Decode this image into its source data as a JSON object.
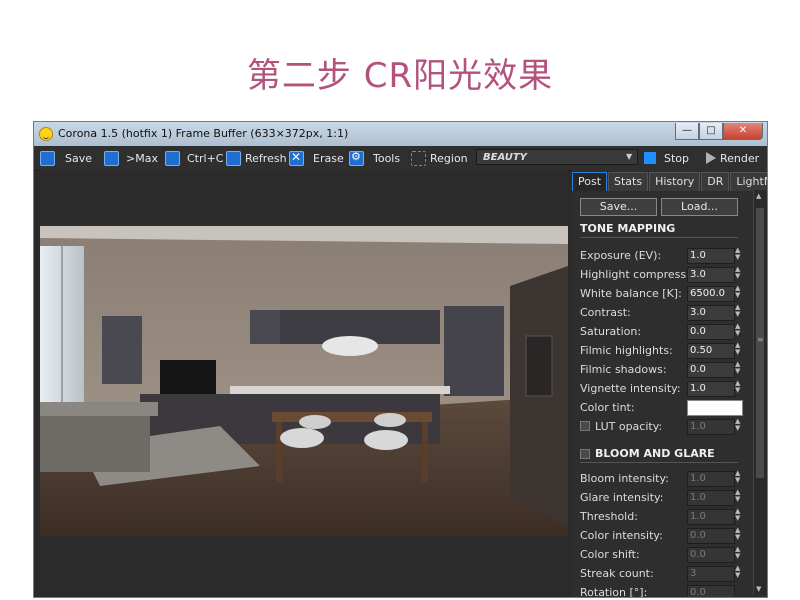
{
  "heading": "第二步  CR阳光效果",
  "window": {
    "title": "Corona 1.5 (hotfix 1) Frame Buffer (633×372px, 1:1)",
    "controls": {
      "minimize": "—",
      "maximize": "□",
      "close": "✕"
    }
  },
  "toolbar": {
    "save": "Save",
    "max": ">Max",
    "ctrl_c": "Ctrl+C",
    "refresh": "Refresh",
    "erase": "Erase",
    "tools": "Tools",
    "region": "Region",
    "pass_select": "BEAUTY",
    "stop": "Stop",
    "render": "Render"
  },
  "panel": {
    "tabs": [
      {
        "label": "Post",
        "active": true
      },
      {
        "label": "Stats"
      },
      {
        "label": "History"
      },
      {
        "label": "DR"
      },
      {
        "label": "LightMix"
      }
    ],
    "save_btn": "Save...",
    "load_btn": "Load...",
    "tone_mapping": {
      "title": "TONE MAPPING",
      "rows": [
        {
          "label": "Exposure (EV):",
          "value": "1.0"
        },
        {
          "label": "Highlight compress:",
          "value": "3.0"
        },
        {
          "label": "White balance [K]:",
          "value": "6500.0"
        },
        {
          "label": "Contrast:",
          "value": "3.0"
        },
        {
          "label": "Saturation:",
          "value": "0.0"
        },
        {
          "label": "Filmic highlights:",
          "value": "0.50"
        },
        {
          "label": "Filmic shadows:",
          "value": "0.0"
        },
        {
          "label": "Vignette intensity:",
          "value": "1.0"
        }
      ],
      "color_tint_label": "Color tint:",
      "color_tint_value": "#ffffff",
      "lut_label": "LUT opacity:",
      "lut_value": "1.0"
    },
    "bloom_glare": {
      "title": "BLOOM AND GLARE",
      "rows": [
        {
          "label": "Bloom intensity:",
          "value": "1.0"
        },
        {
          "label": "Glare intensity:",
          "value": "1.0"
        },
        {
          "label": "Threshold:",
          "value": "1.0"
        },
        {
          "label": "Color intensity:",
          "value": "0.0"
        },
        {
          "label": "Color shift:",
          "value": "0.0"
        },
        {
          "label": "Streak count:",
          "value": "3"
        },
        {
          "label": "Rotation [°]:",
          "value": "0.0"
        }
      ]
    }
  },
  "colors": {
    "heading": "#b2527d",
    "accent": "#1f6fd0",
    "panel_bg": "#2e2e2e"
  }
}
